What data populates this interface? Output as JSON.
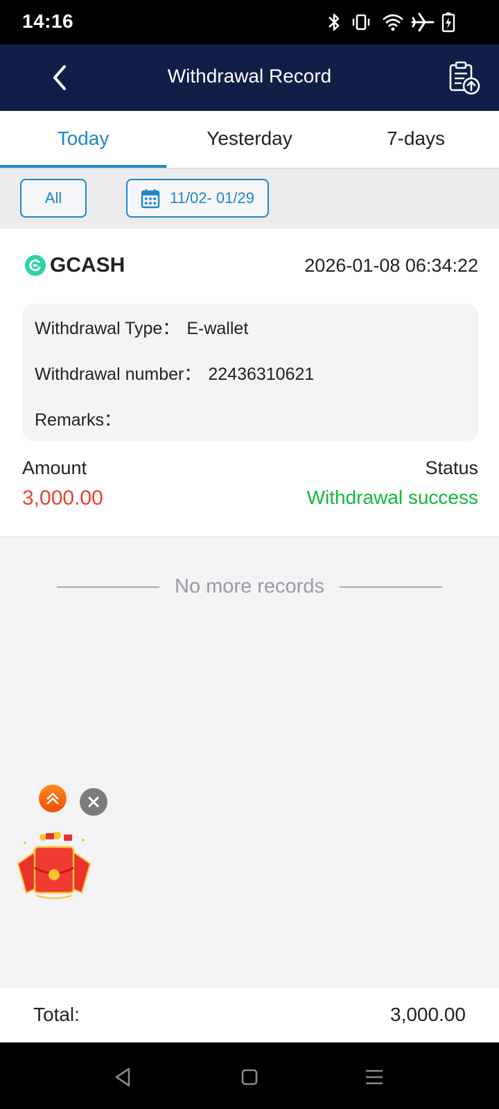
{
  "status_bar": {
    "time": "14:16",
    "icons": [
      "bluetooth-icon",
      "vibrate-icon",
      "wifi-icon",
      "airplane-mode-icon",
      "battery-charging-icon"
    ]
  },
  "header": {
    "title": "Withdrawal Record",
    "back_icon": "chevron-left-icon",
    "action_icon": "clipboard-upload-icon"
  },
  "tabs": [
    {
      "label": "Today",
      "active": true
    },
    {
      "label": "Yesterday",
      "active": false
    },
    {
      "label": "7-days",
      "active": false
    }
  ],
  "filters": {
    "type_label": "All",
    "date_range": "11/02- 01/29",
    "date_icon": "calendar-icon"
  },
  "record": {
    "provider": "GCASH",
    "datetime": "2026-01-08 06:34:22",
    "type_label": "Withdrawal Type：",
    "type_value": "E-wallet",
    "number_label": "Withdrawal number：",
    "number_value": "22436310621",
    "remarks_label": "Remarks：",
    "remarks_value": "",
    "amount_label": "Amount",
    "amount_value": "3,000.00",
    "status_label": "Status",
    "status_value": "Withdrawal success"
  },
  "list_end": "No more records",
  "floating_widget": {
    "up_icon": "double-chevron-up-icon",
    "close_icon": "close-icon",
    "image": "red-envelope-icon"
  },
  "total": {
    "label": "Total:",
    "value": "3,000.00"
  },
  "nav_bar": {
    "buttons": [
      "back-triangle-icon",
      "home-square-icon",
      "menu-lines-icon"
    ]
  },
  "colors": {
    "header_bg": "#101e48",
    "accent_blue": "#1f86c8",
    "amount_red": "#e8432c",
    "success_green": "#12b83a",
    "gcash_teal": "#2ed1a4"
  }
}
